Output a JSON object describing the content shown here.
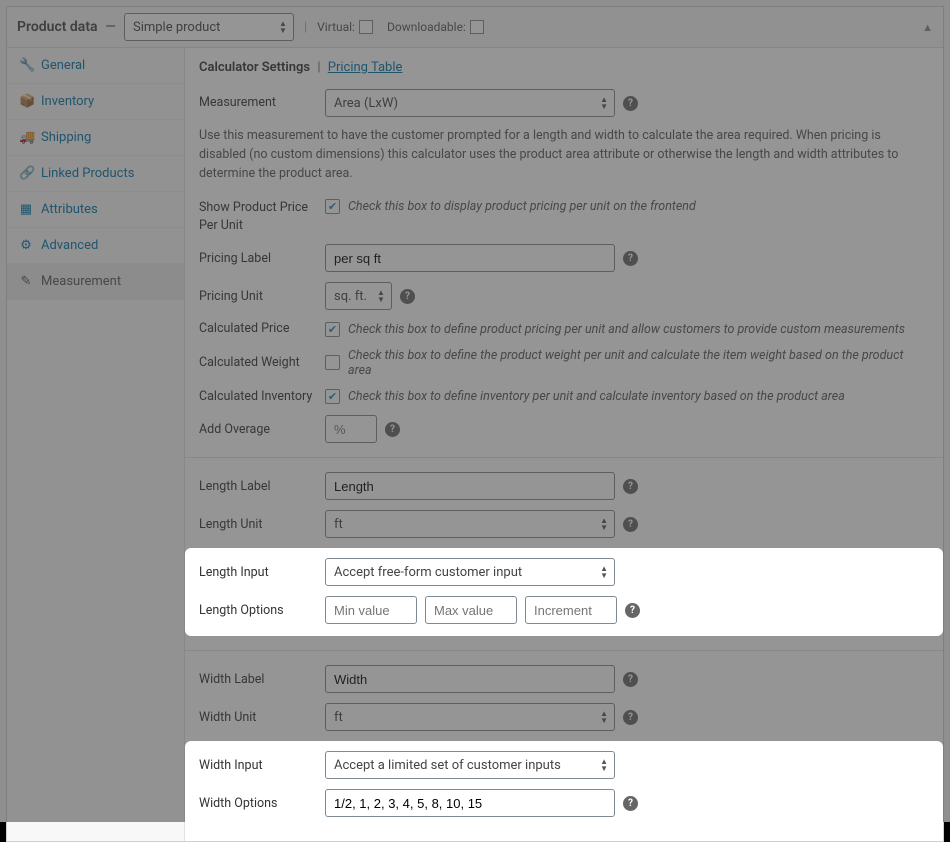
{
  "header": {
    "title": "Product data",
    "typeSelected": "Simple product",
    "virtualLabel": "Virtual:",
    "downloadableLabel": "Downloadable:"
  },
  "tabs": {
    "general": "General",
    "inventory": "Inventory",
    "shipping": "Shipping",
    "linked": "Linked Products",
    "attributes": "Attributes",
    "advanced": "Advanced",
    "measurement": "Measurement"
  },
  "section": {
    "settingsTitle": "Calculator Settings",
    "pricingTableLink": "Pricing Table"
  },
  "labels": {
    "measurement": "Measurement",
    "showPrice": "Show Product Price Per Unit",
    "pricingLabel": "Pricing Label",
    "pricingUnit": "Pricing Unit",
    "calcPrice": "Calculated Price",
    "calcWeight": "Calculated Weight",
    "calcInventory": "Calculated Inventory",
    "addOverage": "Add Overage",
    "lengthLabel": "Length Label",
    "lengthUnit": "Length Unit",
    "lengthInput": "Length Input",
    "lengthOptions": "Length Options",
    "widthLabel": "Width Label",
    "widthUnit": "Width Unit",
    "widthInput": "Width Input",
    "widthOptions": "Width Options"
  },
  "values": {
    "measurement": "Area (LxW)",
    "measurementDesc": "Use this measurement to have the customer prompted for a length and width to calculate the area required. When pricing is disabled (no custom dimensions) this calculator uses the product area attribute or otherwise the length and width attributes to determine the product area.",
    "showPriceHint": "Check this box to display product pricing per unit on the frontend",
    "pricingLabel": "per sq ft",
    "pricingUnit": "sq. ft.",
    "calcPriceHint": "Check this box to define product pricing per unit and allow customers to provide custom measurements",
    "calcWeightHint": "Check this box to define the product weight per unit and calculate the item weight based on the product area",
    "calcInventoryHint": "Check this box to define inventory per unit and calculate inventory based on the product area",
    "overagePlaceholder": "%",
    "lengthLabel": "Length",
    "lengthUnit": "ft",
    "lengthInput": "Accept free-form customer input",
    "minPlaceholder": "Min value",
    "maxPlaceholder": "Max value",
    "incPlaceholder": "Increment",
    "widthLabel": "Width",
    "widthUnit": "ft",
    "widthInput": "Accept a limited set of customer inputs",
    "widthOptions": "1/2, 1, 2, 3, 4, 5, 8, 10, 15"
  }
}
